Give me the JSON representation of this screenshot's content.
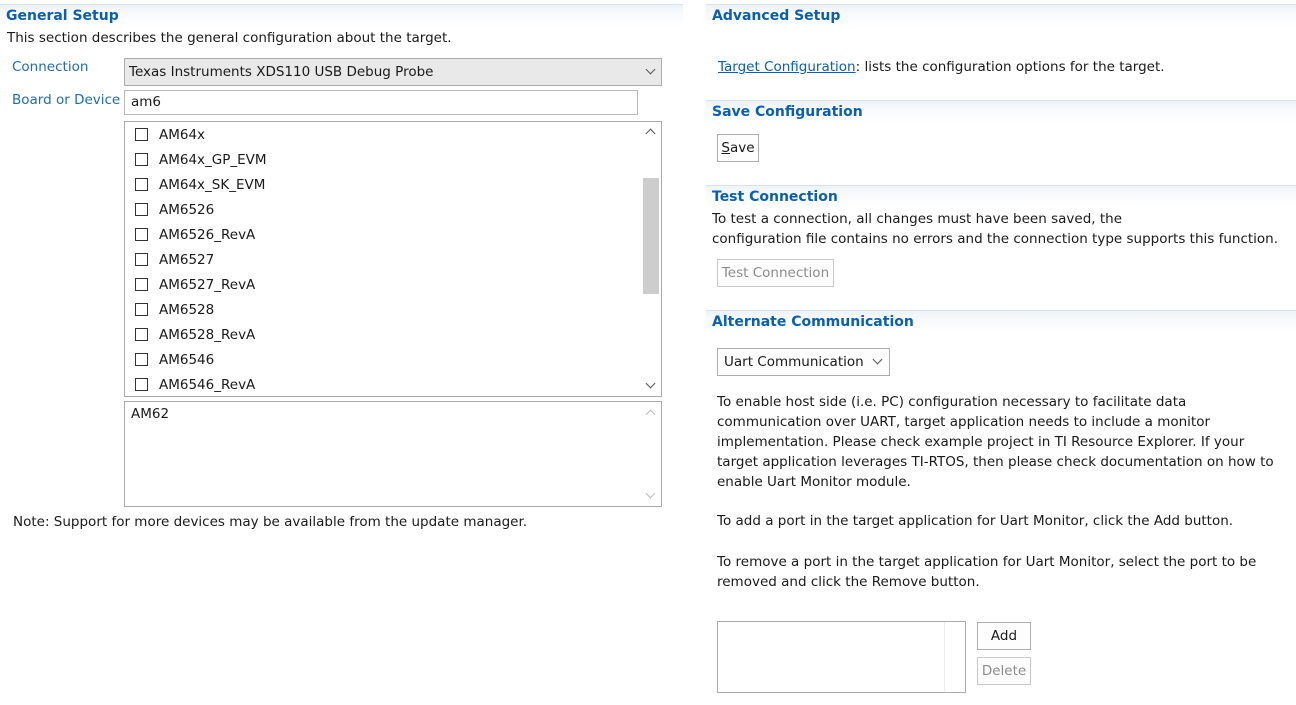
{
  "general_setup": {
    "header": "General Setup",
    "description": "This section describes the general configuration about the target.",
    "connection_label": "Connection",
    "connection_value": "Texas Instruments XDS110 USB Debug Probe",
    "board_label": "Board or Device",
    "board_filter_value": "am6",
    "device_list": [
      {
        "label": "AM64x",
        "checked": false
      },
      {
        "label": "AM64x_GP_EVM",
        "checked": false
      },
      {
        "label": "AM64x_SK_EVM",
        "checked": false
      },
      {
        "label": "AM6526",
        "checked": false
      },
      {
        "label": "AM6526_RevA",
        "checked": false
      },
      {
        "label": "AM6527",
        "checked": false
      },
      {
        "label": "AM6527_RevA",
        "checked": false
      },
      {
        "label": "AM6528",
        "checked": false
      },
      {
        "label": "AM6528_RevA",
        "checked": false
      },
      {
        "label": "AM6546",
        "checked": false
      },
      {
        "label": "AM6546_RevA",
        "checked": false
      }
    ],
    "selected_box_value": "AM62",
    "note": "Note: Support for more devices may be available from the update manager."
  },
  "advanced_setup": {
    "header": "Advanced Setup",
    "target_config_link": "Target Configuration",
    "target_config_text": ": lists the configuration options for the target."
  },
  "save_configuration": {
    "header": "Save Configuration",
    "save_button": "ave",
    "save_button_mnemonic": "S"
  },
  "test_connection": {
    "header": "Test Connection",
    "description_line1": "To test a connection, all changes must have been saved, the",
    "description_line2": "configuration file contains no errors and the connection type supports this function.",
    "button": "Test Connection"
  },
  "alternate_communication": {
    "header": "Alternate Communication",
    "select_value": "Uart Communication",
    "para1_lines": [
      "To enable host side (i.e. PC) configuration necessary to facilitate data",
      "communication over UART, target application needs to include a monitor",
      "implementation. Please check example project in TI Resource Explorer. If your",
      "target application leverages TI-RTOS, then please check documentation on how to",
      "enable Uart Monitor module."
    ],
    "para2": "To add a port in the target application for Uart Monitor, click the Add button.",
    "para3_lines": [
      "To remove a port in the target application for Uart Monitor, select the port to be",
      "removed and click the Remove button."
    ],
    "add_button": "Add",
    "delete_button": "Delete"
  },
  "colors": {
    "header_text": "#0a5fb4",
    "label_text": "#1e6bb8"
  }
}
